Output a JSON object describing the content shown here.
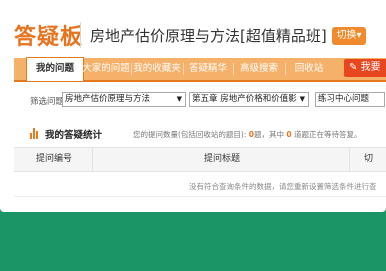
{
  "header": {
    "logo": "答疑板",
    "course_title": "房地产估价原理与方法[超值精品班]",
    "switch_label": "切换▾"
  },
  "nav": {
    "tabs": [
      {
        "label": "我的问题",
        "active": true
      },
      {
        "label": "大家的问题",
        "active": false
      },
      {
        "label": "我的收藏夹",
        "active": false
      },
      {
        "label": "答疑精华",
        "active": false
      },
      {
        "label": "高级搜索",
        "active": false
      },
      {
        "label": "回收站",
        "active": false
      }
    ],
    "ask_button": "我要"
  },
  "filter": {
    "label": "筛选问题",
    "course_select": "房地产估价原理与方法",
    "chapter_select": "第五章  房地产价格和价值影",
    "source_select": "练习中心问题"
  },
  "stats": {
    "title": "我的答疑统计",
    "desc_prefix": "您的提问数量(包括回收站的题目): ",
    "count_total": "0",
    "desc_mid": "题，其中 ",
    "count_pending": "0",
    "desc_suffix": " 道题正在等待答复。"
  },
  "table": {
    "columns": [
      "提问编号",
      "提问标题",
      "切"
    ],
    "empty_message": "没有符合查询条件的数据，请您重新设置筛选条件进行查"
  },
  "colors": {
    "accent": "#e8741f",
    "nav_bg": "#f5b06a",
    "ask_button": "#e8461f",
    "background_band": "#1b9566"
  }
}
